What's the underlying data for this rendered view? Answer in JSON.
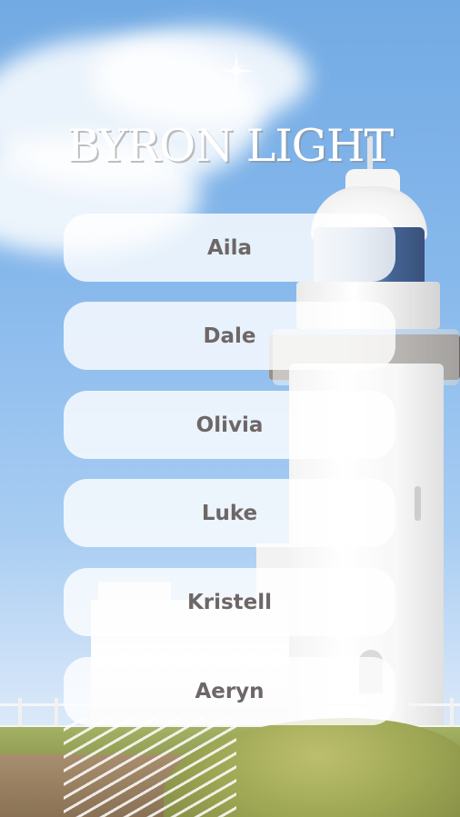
{
  "title": "BYRON LIGHT",
  "links": [
    {
      "label": "Aila"
    },
    {
      "label": "Dale"
    },
    {
      "label": "Olivia"
    },
    {
      "label": "Luke"
    },
    {
      "label": "Kristell"
    },
    {
      "label": "Aeryn"
    }
  ],
  "colors": {
    "button_bg": "#ffffffcc",
    "button_text": "#6e6767",
    "title_text": "#ffffff",
    "sky": "#78b0ea"
  },
  "icons": {
    "sparkle": "four-point-star"
  }
}
